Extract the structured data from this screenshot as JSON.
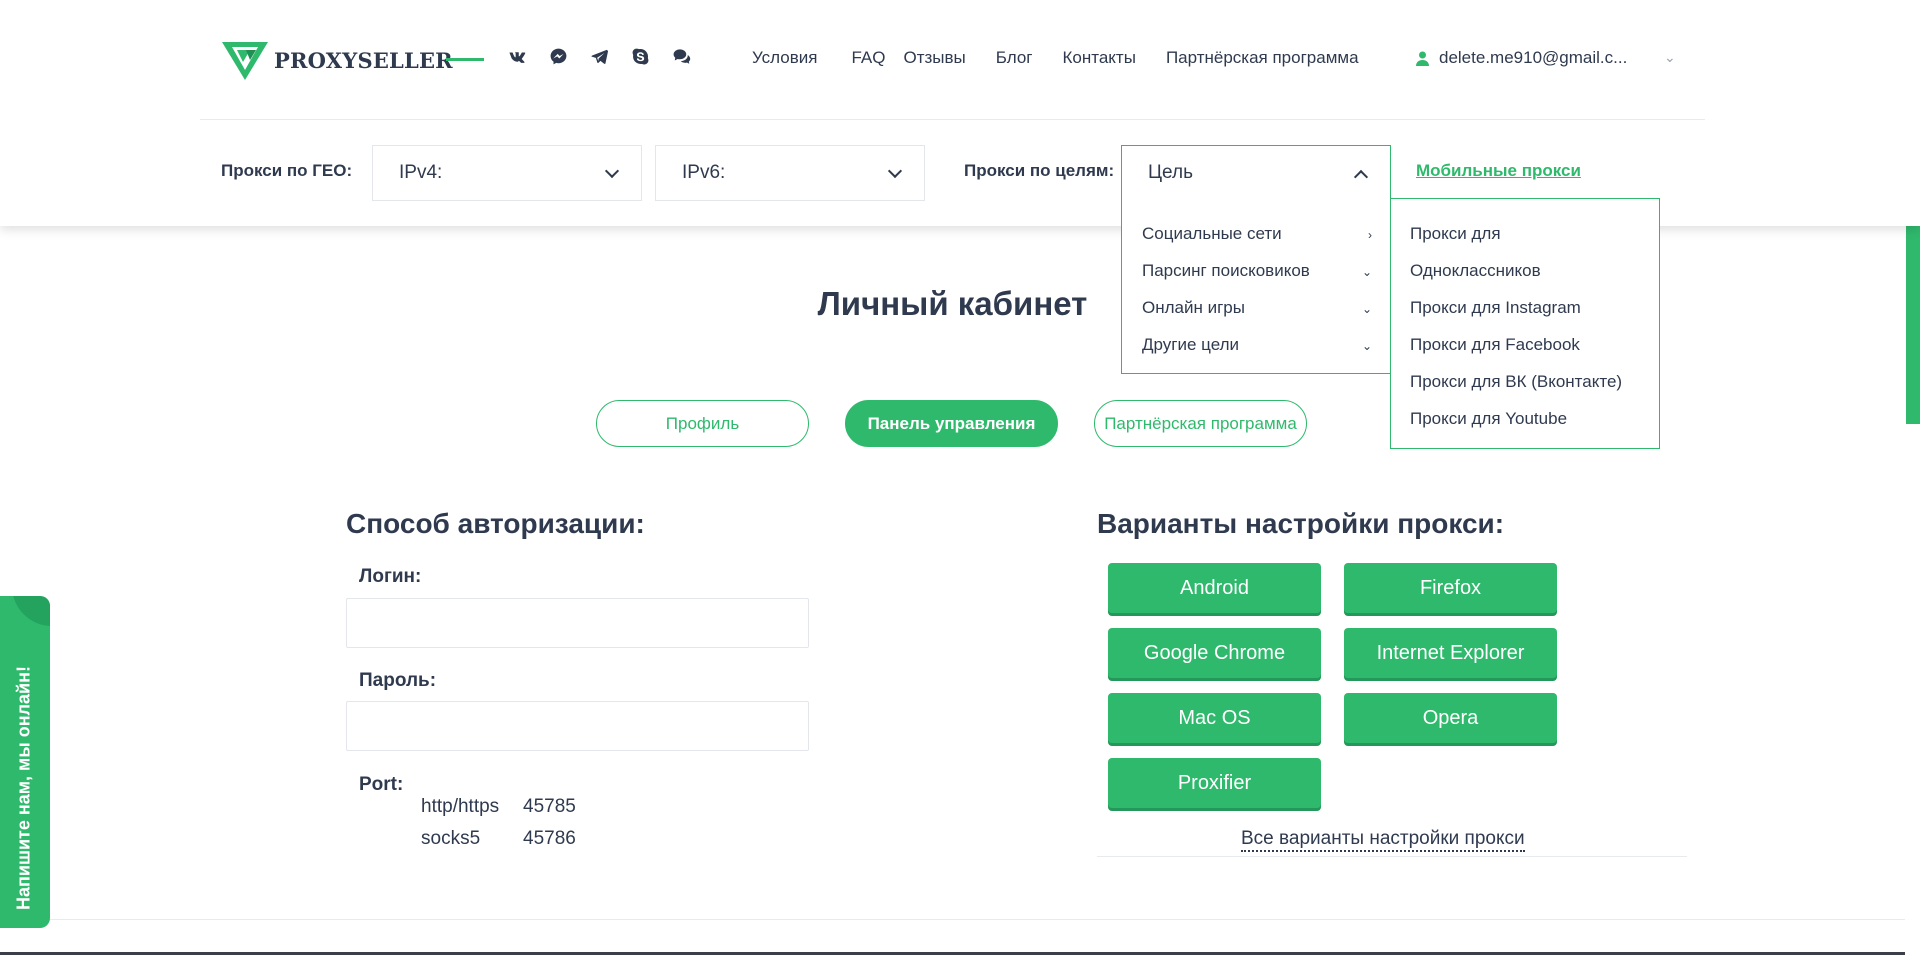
{
  "header": {
    "logo_text": "PROXYSELLER",
    "social_icons": [
      "vk-icon",
      "messenger-icon",
      "telegram-icon",
      "skype-icon",
      "chat-icon"
    ],
    "nav": [
      "Условия",
      "FAQ",
      "Отзывы",
      "Блог",
      "Контакты",
      "Партнёрская программа"
    ],
    "user_email": "delete.me910@gmail.c..."
  },
  "filters": {
    "geo_label": "Прокси по ГЕО:",
    "ipv4": "IPv4:",
    "ipv6": "IPv6:",
    "purpose_label": "Прокси по целям:",
    "purpose_value": "Цель",
    "mobile_link": "Мобильные прокси"
  },
  "dropdown": {
    "main_items": [
      "Социальные сети",
      "Парсинг поисковиков",
      "Онлайн игры",
      "Другие цели"
    ],
    "sub_items": [
      "Прокси для",
      "Одноклассников",
      "Прокси для Instagram",
      "Прокси для Facebook",
      "Прокси для ВК (Вконтакте)",
      "Прокси для Youtube"
    ]
  },
  "main": {
    "title": "Личный кабинет",
    "tabs": [
      "Профиль",
      "Панель управления",
      "Партнёрская программа"
    ],
    "auth_title": "Способ авторизации:",
    "login_label": "Логин:",
    "password_label": "Пароль:",
    "port_label": "Port:",
    "ports": [
      {
        "protocol": "http/https",
        "port": "45785"
      },
      {
        "protocol": "socks5",
        "port": "45786"
      }
    ],
    "settings_title": "Варианты настройки прокси:",
    "setting_buttons": [
      "Android",
      "Firefox",
      "Google Chrome",
      "Internet Explorer",
      "Mac OS",
      "Opera",
      "Proxifier"
    ],
    "all_variants": "Все варианты настройки прокси"
  },
  "chat_widget": {
    "text": "Напишите нам, мы онлайн!"
  },
  "colors": {
    "accent": "#2fb96c",
    "text": "#2f3a4f",
    "border": "#e3e6ea"
  }
}
